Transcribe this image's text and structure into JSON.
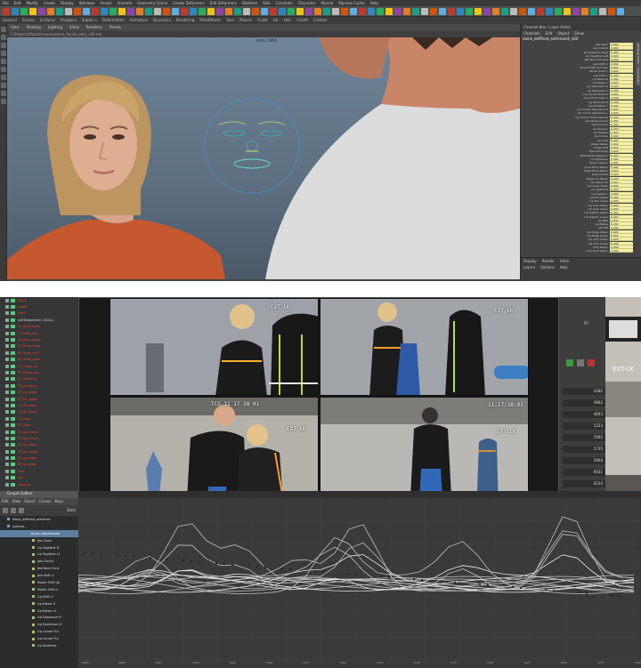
{
  "maya": {
    "menu": [
      "File",
      "Edit",
      "Modify",
      "Create",
      "Display",
      "Windows",
      "Assets",
      "Animate",
      "Geometry Cache",
      "Create Deformers",
      "Edit Deformers",
      "Skeleton",
      "Skin",
      "Constrain",
      "Character",
      "Muscle",
      "Pipeline Cache",
      "Help"
    ],
    "shelf_tabs": [
      "General",
      "Curves",
      "Surfaces",
      "Polygons",
      "Subdiv s",
      "Deformation",
      "Animation",
      "Dynamics",
      "Rendering",
      "PaintEffects",
      "Toon",
      "Muscle",
      "Fluids",
      "Fur",
      "Hair",
      "nCloth",
      "Custom"
    ],
    "viewport_menu": [
      "View",
      "Shading",
      "Lighting",
      "Show",
      "Renderer",
      "Panels"
    ],
    "viewport_path": "C:/Projects/Facial/scenes/elena_facial_anim_v04.ma",
    "camera_label": "Verts: 1856",
    "channel_box": {
      "tabs": [
        "Channel Box / Layer Editor"
      ],
      "menu": [
        "Channels",
        "Edit",
        "Object",
        "Show"
      ],
      "object": "elena_deffined_extremes4_v04",
      "channels": [
        {
          "name": "Jaw Open",
          "value": "0.000"
        },
        {
          "name": "Jaw Clench",
          "value": "0.000"
        },
        {
          "name": "Lip Together Right",
          "value": "0.000"
        },
        {
          "name": "Lip Together Left",
          "value": "0.000"
        },
        {
          "name": "Jaw Back Forward",
          "value": "0.000"
        },
        {
          "name": "Jaw Shift Lr",
          "value": "0.000"
        },
        {
          "name": "Mouth Shift Up Down",
          "value": "0.000"
        },
        {
          "name": "Mouth Shift Lr",
          "value": "0.000"
        },
        {
          "name": "Lip Shift Lr",
          "value": "0.000"
        },
        {
          "name": "Lip Raiser R",
          "value": "0.000"
        },
        {
          "name": "Lip Raiser L",
          "value": "0.000"
        },
        {
          "name": "Lip Depressor R",
          "value": "0.000"
        },
        {
          "name": "Lip Depressor L",
          "value": "0.000"
        },
        {
          "name": "Lip Corner Puller R",
          "value": "0.000"
        },
        {
          "name": "Lip Corner Puller L",
          "value": "0.000"
        },
        {
          "name": "Lip Stretcher R",
          "value": "0.000"
        },
        {
          "name": "Lip Stretcher L",
          "value": "0.000"
        },
        {
          "name": "Lip Corner Depressor R",
          "value": "0.000"
        },
        {
          "name": "Lip Corner Depressor L",
          "value": "0.000"
        },
        {
          "name": "Lip Corner Puller Narrow",
          "value": "0.000"
        },
        {
          "name": "Lip Sharp Corner",
          "value": "0.000"
        },
        {
          "name": "Lip Funneler",
          "value": "0.000"
        },
        {
          "name": "Lip Dimpler",
          "value": "0.000"
        },
        {
          "name": "Lip Presser",
          "value": "0.000"
        },
        {
          "name": "Lip Pucker",
          "value": "0.000"
        },
        {
          "name": "Lip Suck",
          "value": "0.000"
        },
        {
          "name": "Cheek Raiser",
          "value": "0.000"
        },
        {
          "name": "Cheek Puff",
          "value": "0.000"
        },
        {
          "name": "Nose Wrinkler",
          "value": "0.000"
        },
        {
          "name": "Nasolabial Deepener",
          "value": "0.000"
        },
        {
          "name": "Lid Tightener",
          "value": "0.000"
        },
        {
          "name": "Brow Lowerer",
          "value": "0.000"
        },
        {
          "name": "Inner Brow Raiser",
          "value": "0.000"
        },
        {
          "name": "Outer Brow Raiser",
          "value": "0.000"
        },
        {
          "name": "Eyes Closed",
          "value": "0.000"
        },
        {
          "name": "Upper Lid Raiser",
          "value": "0.000"
        },
        {
          "name": "Lip Upper Up",
          "value": "0.000"
        },
        {
          "name": "Lip Lower Down",
          "value": "0.000"
        },
        {
          "name": "Lip Tighter R",
          "value": "0.000"
        },
        {
          "name": "Lip Tighter L",
          "value": "0.000"
        },
        {
          "name": "Lip Roll Upper",
          "value": "0.000"
        },
        {
          "name": "Lip Roll Lower",
          "value": "0.000"
        },
        {
          "name": "Lip Suck Upper",
          "value": "0.000"
        },
        {
          "name": "Lip Suck Lower",
          "value": "0.000"
        },
        {
          "name": "Lip Tighten Upper",
          "value": "0.000"
        },
        {
          "name": "Lip Tighten Lower",
          "value": "0.000"
        },
        {
          "name": "Lip Bite",
          "value": "0.000"
        },
        {
          "name": "Lip Nibble",
          "value": "0.000"
        },
        {
          "name": "Lip Puff",
          "value": "0.000"
        },
        {
          "name": "Lip Bulge Upper",
          "value": "0.000"
        },
        {
          "name": "Lip Bulge Lower",
          "value": "0.000"
        },
        {
          "name": "Lip Tuck Upper",
          "value": "0.000"
        },
        {
          "name": "Lip Tuck Lower",
          "value": "0.000"
        },
        {
          "name": "Chin Raiser",
          "value": "0.000"
        },
        {
          "name": "Chin Pout Upper",
          "value": "0.000"
        }
      ],
      "layer_tabs": [
        "Display",
        "Render",
        "Anim"
      ],
      "layer_menu": [
        "Layers",
        "Options",
        "Help"
      ],
      "side_tabs": [
        "Attribute Editor",
        "Channel Box"
      ]
    }
  },
  "mocap": {
    "outliner": {
      "items": [
        {
          "label": "elena",
          "color": "red"
        },
        {
          "label": "drake",
          "color": "red"
        },
        {
          "label": "head",
          "color": "red"
        },
        {
          "label": "ueElSequencer_2404_1",
          "color": "white"
        },
        {
          "label": "LF_brow_inner",
          "color": "red"
        },
        {
          "label": "LF_brow_mid",
          "color": "red"
        },
        {
          "label": "LF_brow_outer",
          "color": "red"
        },
        {
          "label": "RT_brow_inner",
          "color": "red"
        },
        {
          "label": "RT_brow_mid",
          "color": "red"
        },
        {
          "label": "RT_brow_outer",
          "color": "red"
        },
        {
          "label": "LF_cheek_up",
          "color": "red"
        },
        {
          "label": "RT_cheek_up",
          "color": "red"
        },
        {
          "label": "LF_cheek_lo",
          "color": "red"
        },
        {
          "label": "RT_cheek_lo",
          "color": "red"
        },
        {
          "label": "LF_lid_upper",
          "color": "red"
        },
        {
          "label": "RT_lid_upper",
          "color": "red"
        },
        {
          "label": "LF_lid_lower",
          "color": "red"
        },
        {
          "label": "RT_lid_lower",
          "color": "red"
        },
        {
          "label": "LF_nose",
          "color": "red"
        },
        {
          "label": "RT_nose",
          "color": "red"
        },
        {
          "label": "LF_lip_corner",
          "color": "red"
        },
        {
          "label": "RT_lip_corner",
          "color": "red"
        },
        {
          "label": "LF_lip_upper",
          "color": "red"
        },
        {
          "label": "RT_lip_upper",
          "color": "red"
        },
        {
          "label": "LF_lip_lower",
          "color": "red"
        },
        {
          "label": "RT_lip_lower",
          "color": "red"
        },
        {
          "label": "chin",
          "color": "red"
        },
        {
          "label": "jaw",
          "color": "red"
        },
        {
          "label": "nose_tip",
          "color": "red"
        }
      ]
    },
    "video": {
      "cells": [
        {
          "tc": "",
          "badge": "EXT-LK"
        },
        {
          "tc": "",
          "badge": "EXT-LK"
        },
        {
          "tc": "TCG 11 17 38 01",
          "badge": "EXT-LK"
        },
        {
          "tc": "11:17:38:01",
          "badge": "EXT-LK"
        }
      ],
      "frame_readout": "6905 / 7325"
    },
    "right_panel": {
      "header_label": "FP",
      "badge": "EXT-LK",
      "numbers": [
        "4282",
        "4962",
        "4643",
        "5223",
        "5565",
        "5735",
        "5964",
        "6021",
        "6214",
        "6462"
      ]
    },
    "graph_editor": {
      "title": "Graph Editor",
      "menu": [
        "Edit",
        "View",
        "Select",
        "Curves",
        "Keys"
      ],
      "stats_label": "Stats",
      "objects": [
        {
          "label": "elena_deffined_extremes",
          "selected": false
        },
        {
          "label": "outlines",
          "selected": false
        },
        {
          "label": "facial_adjustments",
          "selected": true
        },
        {
          "label": "Jaw Open",
          "selected": false
        },
        {
          "label": "Lip Together R",
          "selected": false
        },
        {
          "label": "Lip Together Lf",
          "selected": false
        },
        {
          "label": "Jaw Clench",
          "selected": false
        },
        {
          "label": "Jaw Back Forw",
          "selected": false
        },
        {
          "label": "Jaw Shift Lr",
          "selected": false
        },
        {
          "label": "Mouth Shift Up",
          "selected": false
        },
        {
          "label": "Mouth Shift Lr",
          "selected": false
        },
        {
          "label": "Lip Shift Lr",
          "selected": false
        },
        {
          "label": "Lip Raiser R",
          "selected": false
        },
        {
          "label": "Lip Raiser Lf",
          "selected": false
        },
        {
          "label": "Lip Depressor R",
          "selected": false
        },
        {
          "label": "Lip Depressor Lf",
          "selected": false
        },
        {
          "label": "Lip Corner Pul",
          "selected": false
        },
        {
          "label": "Lip Corner Pul",
          "selected": false
        },
        {
          "label": "Lip Stretcher",
          "selected": false
        }
      ],
      "ticks": [
        "6925",
        "6950",
        "6975",
        "7000",
        "7025",
        "7050",
        "7075",
        "7100",
        "7125",
        "7150",
        "7175",
        "7200",
        "7225",
        "7250",
        "7275",
        "7300"
      ]
    }
  }
}
